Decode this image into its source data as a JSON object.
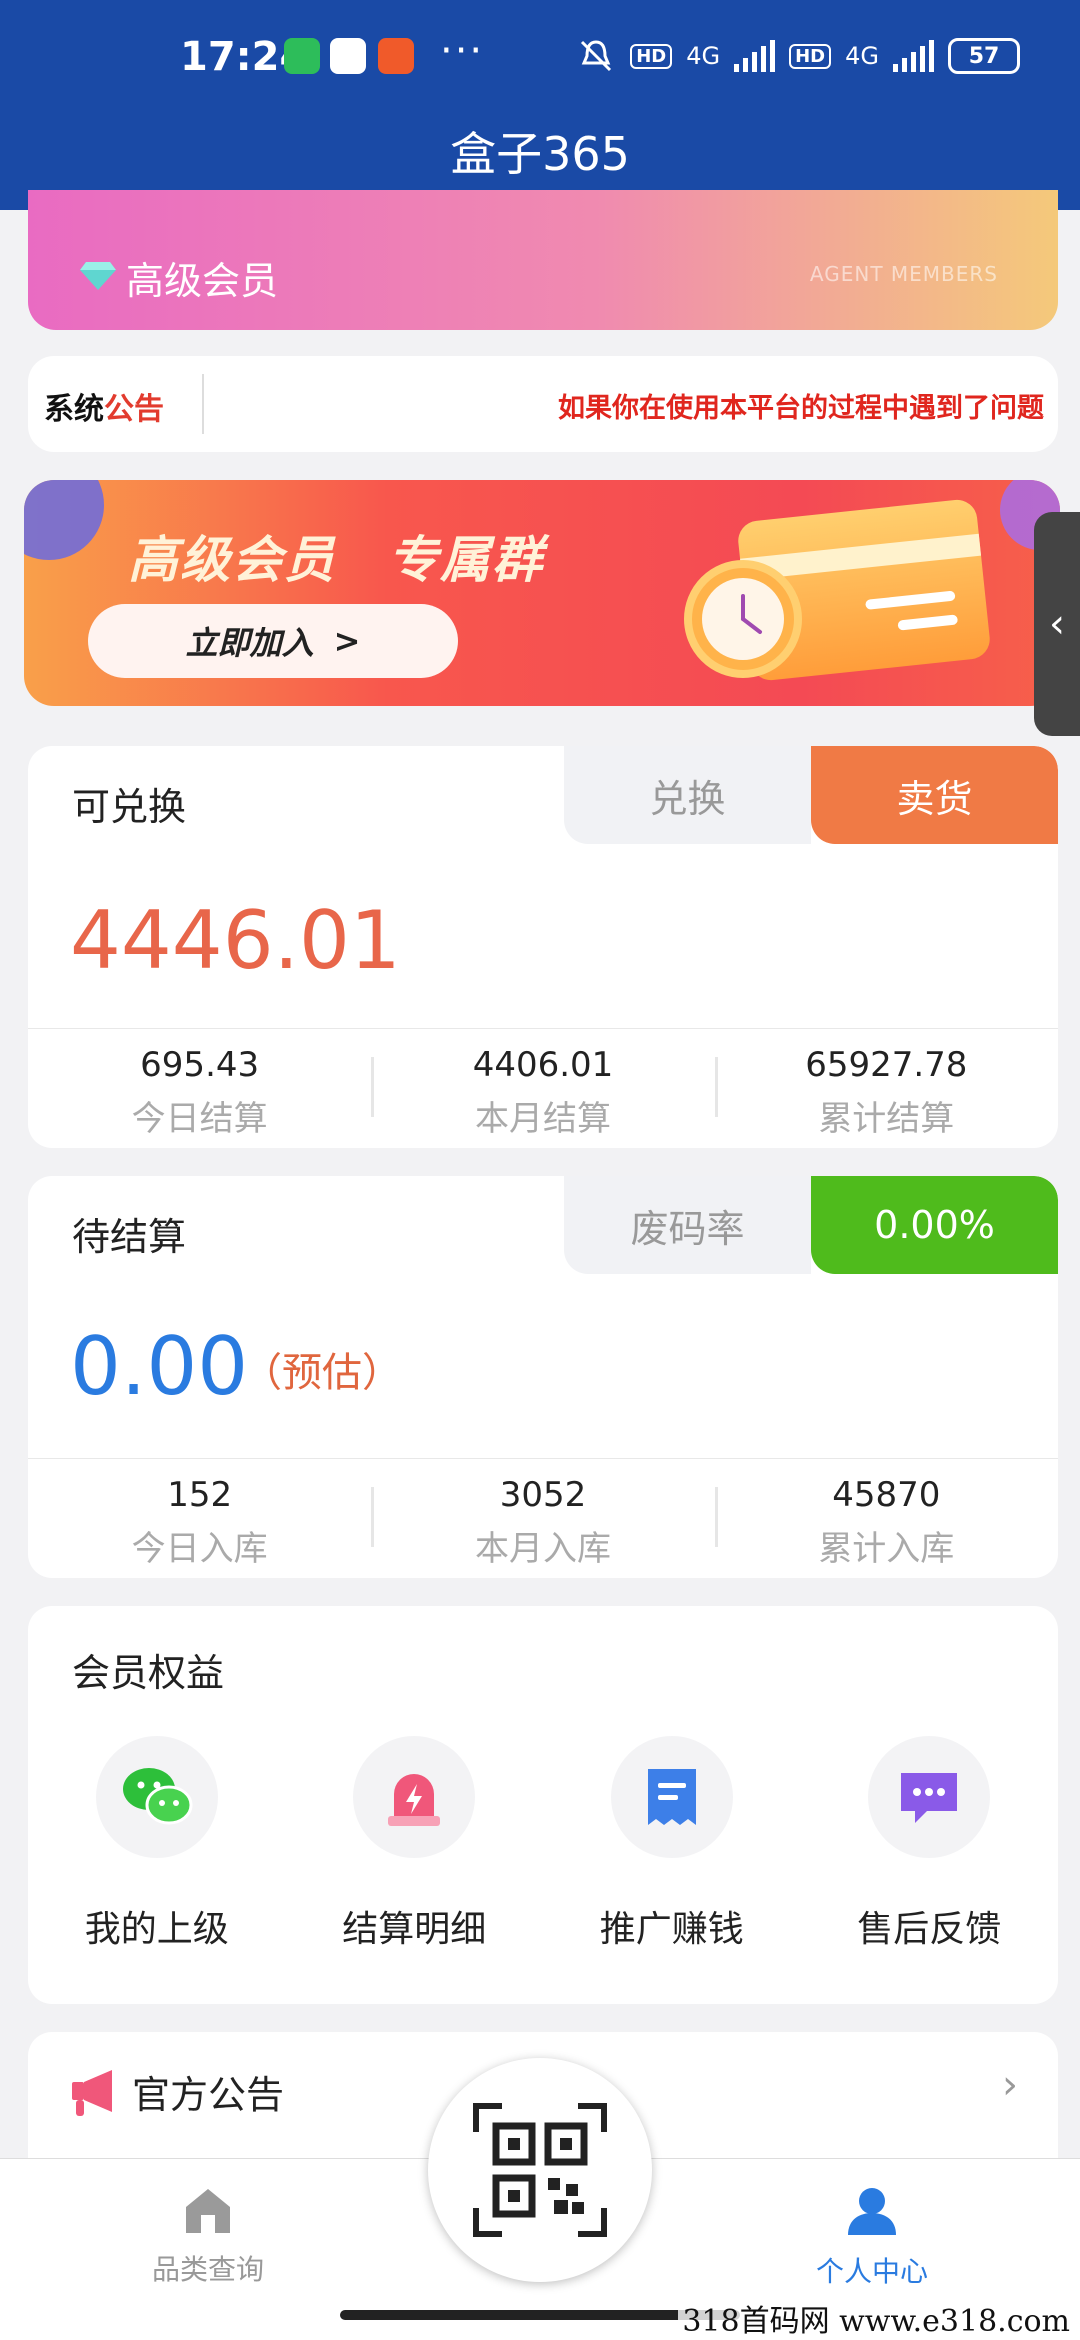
{
  "status_bar": {
    "time": "17:24",
    "more": "···",
    "hd1": "HD",
    "net1": "4G",
    "hd2": "HD",
    "net2": "4G",
    "battery": "57"
  },
  "header": {
    "title": "盒子365"
  },
  "member_card": {
    "label": "高级会员",
    "english": "AGENT MEMBERS"
  },
  "notice": {
    "tag_part1": "系统",
    "tag_part2": "公告",
    "text": "如果你在使用本平台的过程中遇到了问题"
  },
  "banner": {
    "title": "高级会员　专属群",
    "button": "立即加入",
    "button_arrow": ">"
  },
  "side_tab": {
    "icon": "chevron-left-icon",
    "glyph": "‹"
  },
  "exchange_panel": {
    "title": "可兑换",
    "tab_exchange": "兑换",
    "tab_sell": "卖货",
    "value": "4446.01",
    "value_color": "#e8664a",
    "stats": [
      {
        "value": "695.43",
        "label": "今日结算"
      },
      {
        "value": "4406.01",
        "label": "本月结算"
      },
      {
        "value": "65927.78",
        "label": "累计结算"
      }
    ]
  },
  "pending_panel": {
    "title": "待结算",
    "tab_waste": "废码率",
    "tab_rate": "0.00%",
    "value": "0.00",
    "value_color": "#2a7be0",
    "estimate": "（预估）",
    "stats": [
      {
        "value": "152",
        "label": "今日入库"
      },
      {
        "value": "3052",
        "label": "本月入库"
      },
      {
        "value": "45870",
        "label": "累计入库"
      }
    ]
  },
  "benefits": {
    "title": "会员权益",
    "items": [
      {
        "label": "我的上级",
        "icon": "wechat-icon"
      },
      {
        "label": "结算明细",
        "icon": "alarm-icon"
      },
      {
        "label": "推广赚钱",
        "icon": "receipt-icon"
      },
      {
        "label": "售后反馈",
        "icon": "chat-icon"
      }
    ]
  },
  "official": {
    "label": "官方公告",
    "chevron": "›"
  },
  "bottom_nav": {
    "home": "品类查询",
    "me": "个人中心"
  },
  "watermark": "318首码网 www.e318.com",
  "colors": {
    "brand": "#1a4aa6",
    "orange": "#f07a45",
    "green": "#4fbb1c"
  }
}
